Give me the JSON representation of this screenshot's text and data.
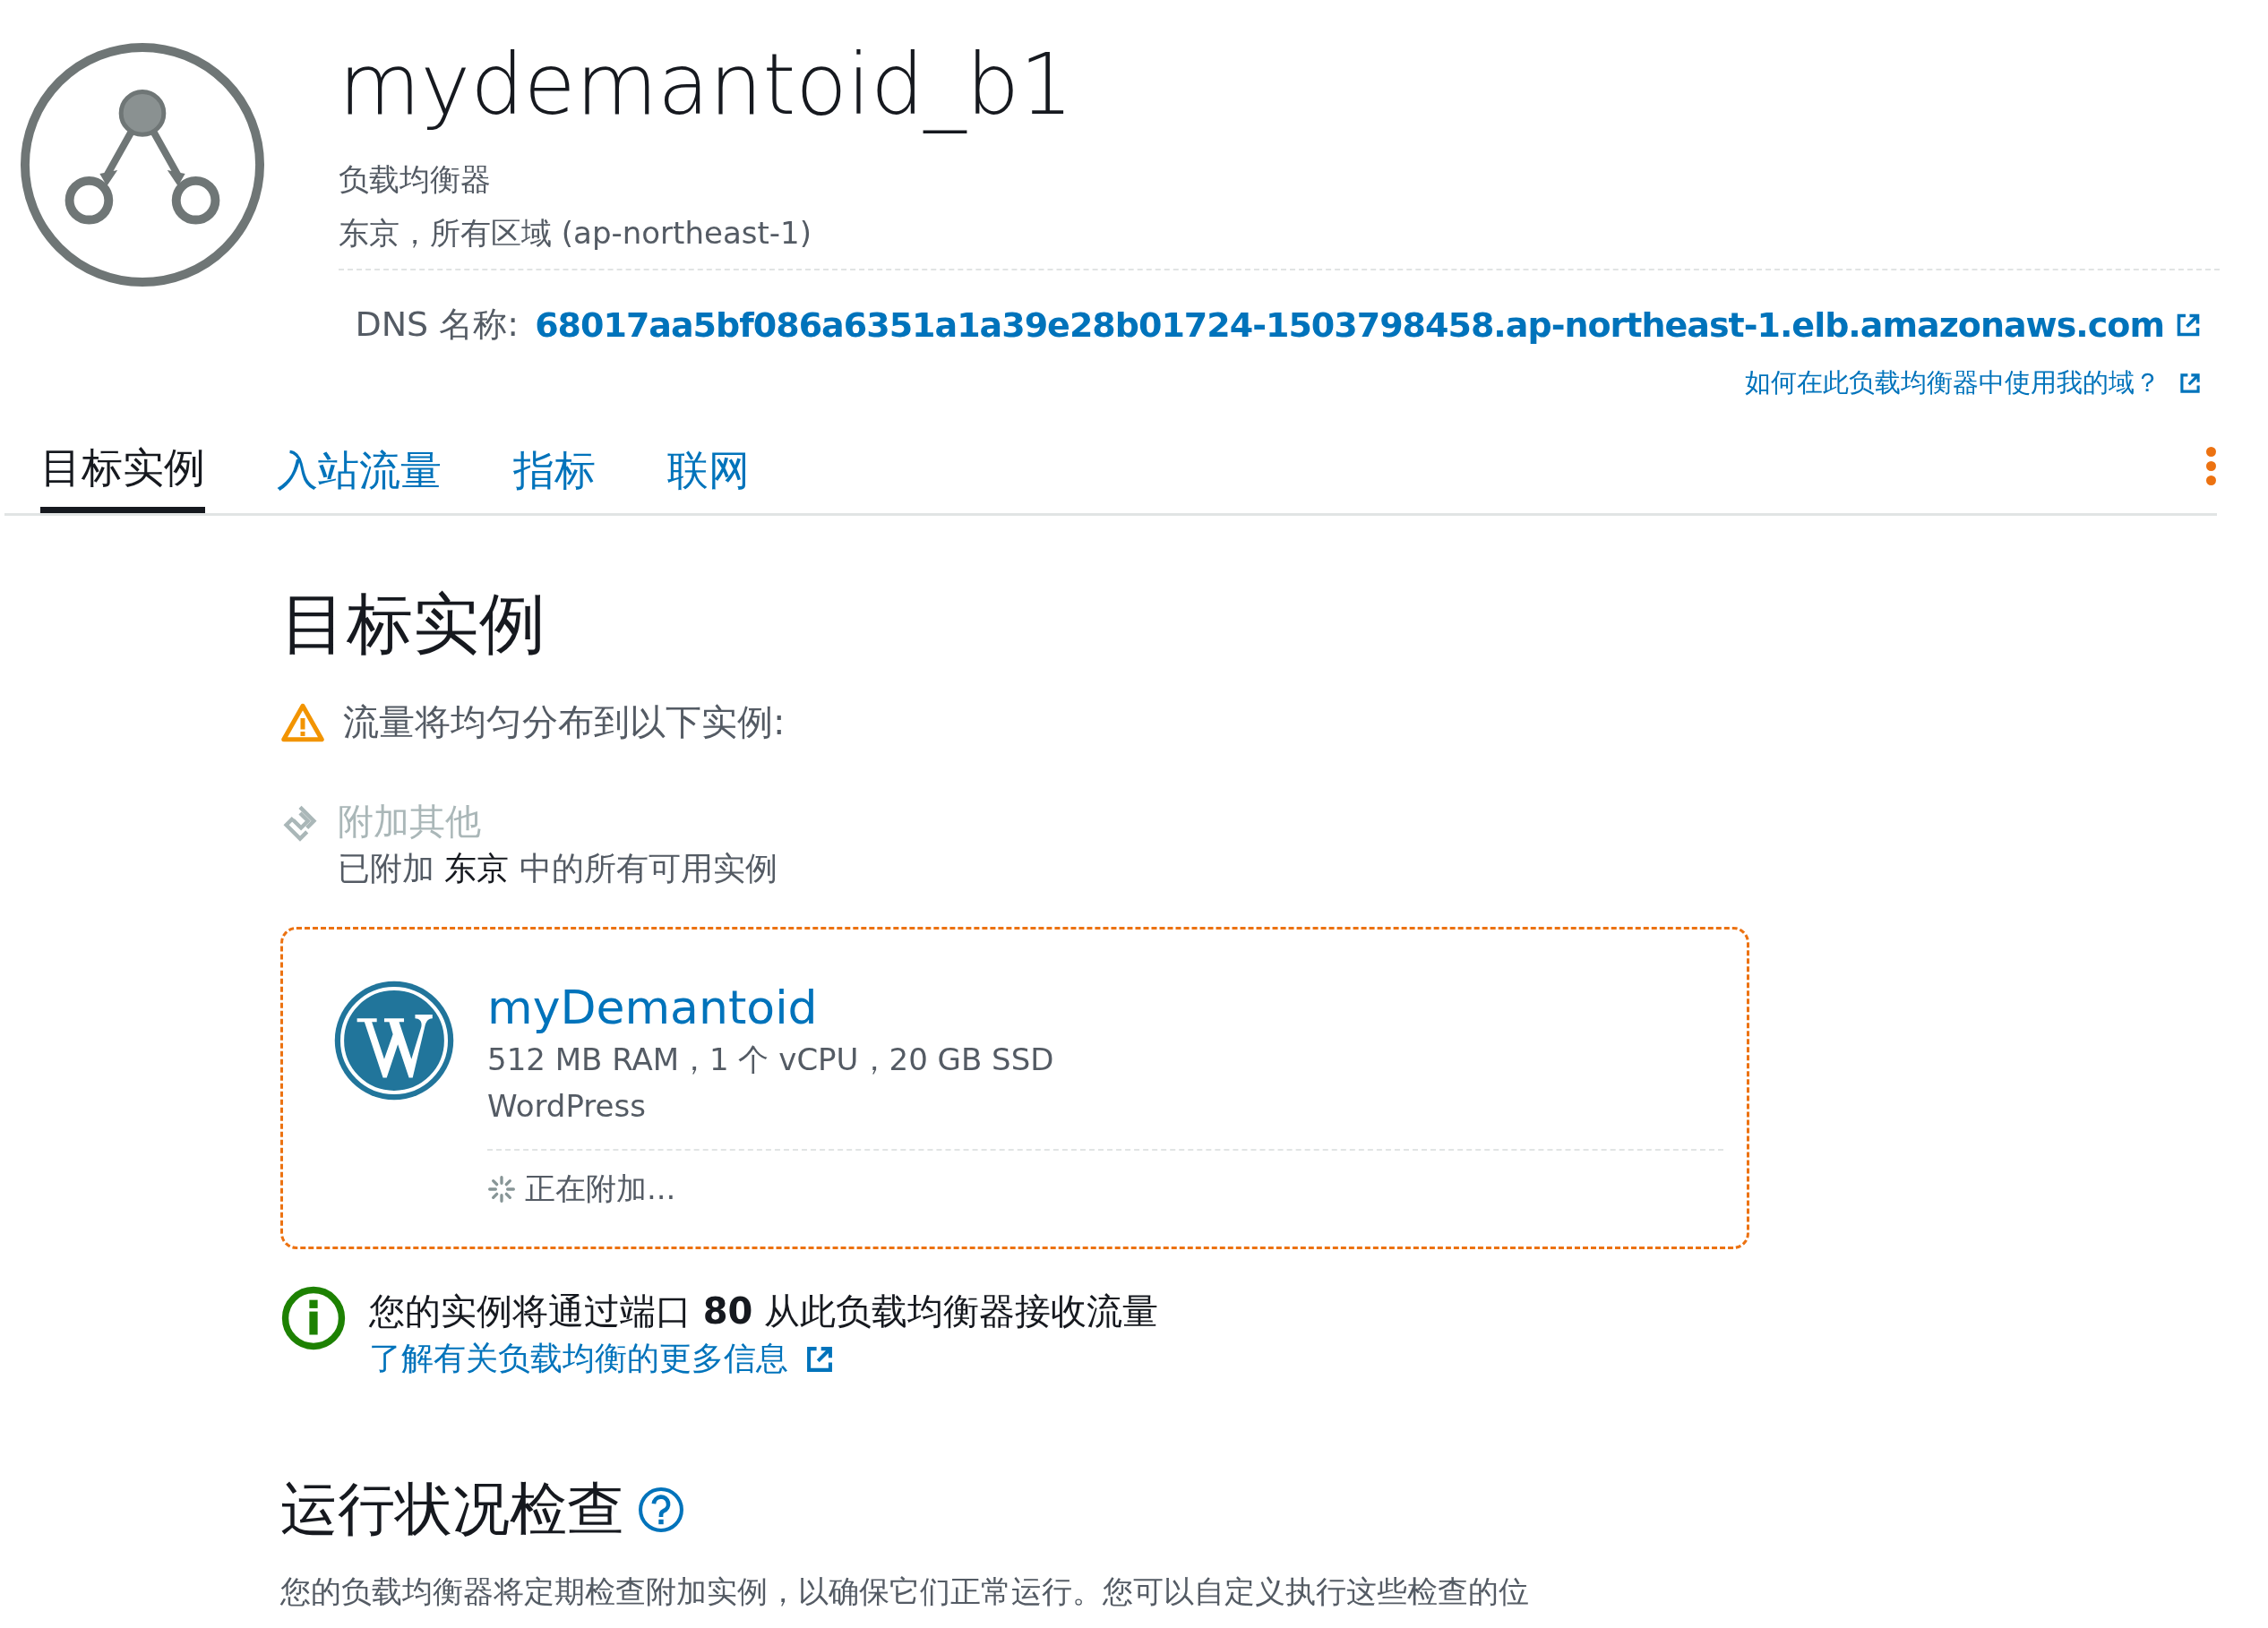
{
  "header": {
    "title": "mydemantoid_b1",
    "type": "负载均衡器",
    "region": "东京，所有区域 (ap-northeast-1)",
    "dns_label": "DNS 名称:",
    "dns_value": "68017aa5bf086a6351a1a39e28b01724-1503798458.ap-northeast-1.elb.amazonaws.com",
    "help_link": "如何在此负载均衡器中使用我的域？"
  },
  "tabs": [
    {
      "label": "目标实例",
      "selected": true
    },
    {
      "label": "入站流量",
      "selected": false
    },
    {
      "label": "指标",
      "selected": false
    },
    {
      "label": "联网",
      "selected": false
    }
  ],
  "section": {
    "heading": "目标实例",
    "warning": "流量将均匀分布到以下实例:",
    "attach_label": "附加其他",
    "attach_note": "已附加 **东京** 中的所有可用实例",
    "instance": {
      "name": "myDemantoid",
      "specs": "512 MB RAM，1 个 vCPU，20 GB SSD",
      "blueprint": "WordPress",
      "status": "正在附加..."
    },
    "info": "您的实例将通过端口 **80** 从此负载均衡器接收流量",
    "info_link": "了解有关负载均衡的更多信息"
  },
  "health": {
    "heading": "运行状况检查",
    "description": "您的负载均衡器将定期检查附加实例，以确保它们正常运行。您可以自定义执行这些检查的位"
  }
}
